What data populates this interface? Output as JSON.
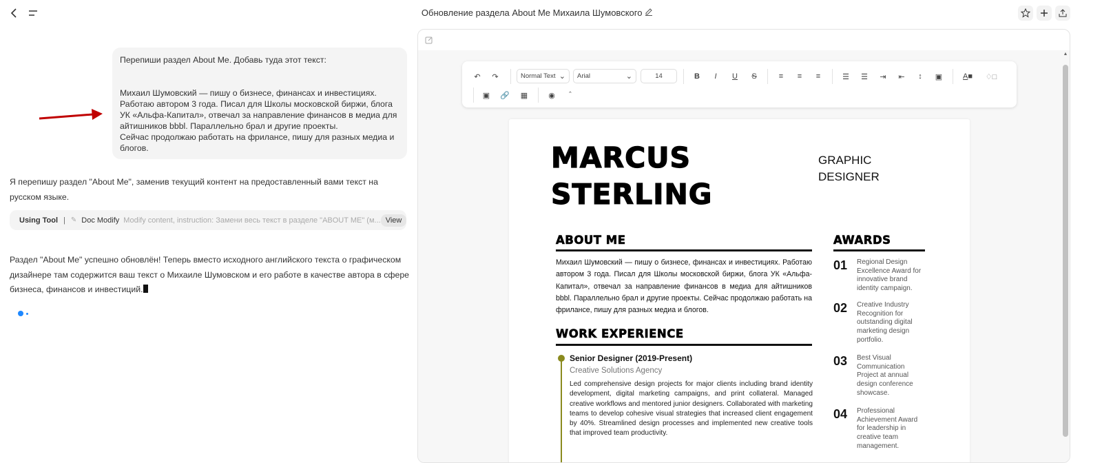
{
  "header": {
    "title": "Обновление раздела About Me Михаила Шумовского"
  },
  "chat": {
    "user_message": "Перепиши раздел About Me. Добавь туда этот текст:\n\n\nМихаил Шумовский — пишу о бизнесе, финансах и инвестициях. Работаю автором 3 года. Писал для Школы московской биржи, блога УК «Альфа-Капитал», отвечал за направление финансов в медиа для айтишников bbbl. Параллельно брал и другие проекты.\nСейчас продолжаю работать на фрилансе, пишу для разных медиа и блогов.",
    "assistant_reply_1": "Я перепишу раздел \"About Me\", заменив текущий контент на предоставленный вами текст на русском языке.",
    "tool": {
      "label": "Using Tool",
      "separator": "|",
      "name": "Doc Modify",
      "description": "Modify content, instruction: Замени весь текст в разделе \"ABOUT ME\" (м...",
      "view": "View"
    },
    "assistant_reply_2": "Раздел \"About Me\" успешно обновлён! Теперь вместо исходного английского текста о графическом дизайнере там содержится ваш текст о Михаиле Шумовском и его работе в качестве автора в сфере бизнеса, финансов и инвестиций."
  },
  "toolbar": {
    "style": "Normal Text",
    "font": "Arial",
    "size": "14"
  },
  "resume": {
    "first_name": "MARCUS",
    "last_name": "STERLING",
    "role_1": "GRAPHIC",
    "role_2": "DESIGNER",
    "about_heading": "ABOUT ME",
    "about_text": "Михаил Шумовский — пишу о бизнесе, финансах и инвестициях. Работаю автором 3 года. Писал для Школы московской биржи, блога УК «Альфа-Капитал», отвечал за направление финансов в медиа для айтишников bbbl. Параллельно брал и другие проекты. Сейчас продолжаю работать на фрилансе, пишу для разных медиа и блогов.",
    "work_heading": "WORK EXPERIENCE",
    "job": {
      "title": "Senior Designer (2019-Present)",
      "company": "Creative Solutions Agency",
      "description": "Led comprehensive design projects for major clients including brand identity development, digital marketing campaigns, and print collateral. Managed creative workflows and mentored junior designers. Collaborated with marketing teams to develop cohesive visual strategies that increased client engagement by 40%. Streamlined design processes and implemented new creative tools that improved team productivity."
    },
    "awards_heading": "AWARDS",
    "awards": [
      {
        "n": "01",
        "t": "Regional Design Excellence Award for innovative brand identity campaign."
      },
      {
        "n": "02",
        "t": "Creative Industry Recognition for outstanding digital marketing design portfolio."
      },
      {
        "n": "03",
        "t": "Best Visual Communication Project at annual design conference showcase."
      },
      {
        "n": "04",
        "t": "Professional Achievement Award for leadership in creative team management."
      }
    ]
  },
  "colors": {
    "accent": "#1e88ff",
    "timeline": "#8a8a1e",
    "arrow": "#c00000"
  }
}
